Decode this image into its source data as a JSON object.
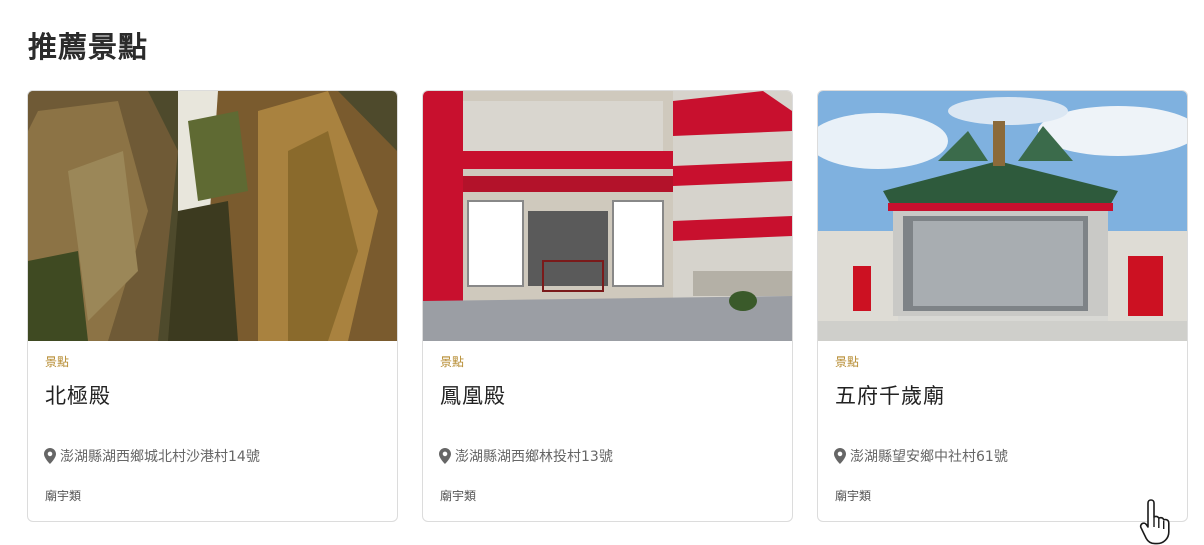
{
  "section": {
    "title": "推薦景點"
  },
  "cards": [
    {
      "category": "景點",
      "title": "北極殿",
      "address": "澎湖縣湖西鄉城北村沙港村14號",
      "type": "廟宇類"
    },
    {
      "category": "景點",
      "title": "鳳凰殿",
      "address": "澎湖縣湖西鄉林投村13號",
      "type": "廟宇類"
    },
    {
      "category": "景點",
      "title": "五府千歲廟",
      "address": "澎湖縣望安鄉中社村61號",
      "type": "廟宇類"
    }
  ],
  "icons": {
    "location": "map-pin-icon",
    "cursor": "hand-pointer-icon"
  },
  "colors": {
    "category": "#b58a2e",
    "card_border": "#dcdcdc",
    "temple_red": "#c8102e"
  }
}
